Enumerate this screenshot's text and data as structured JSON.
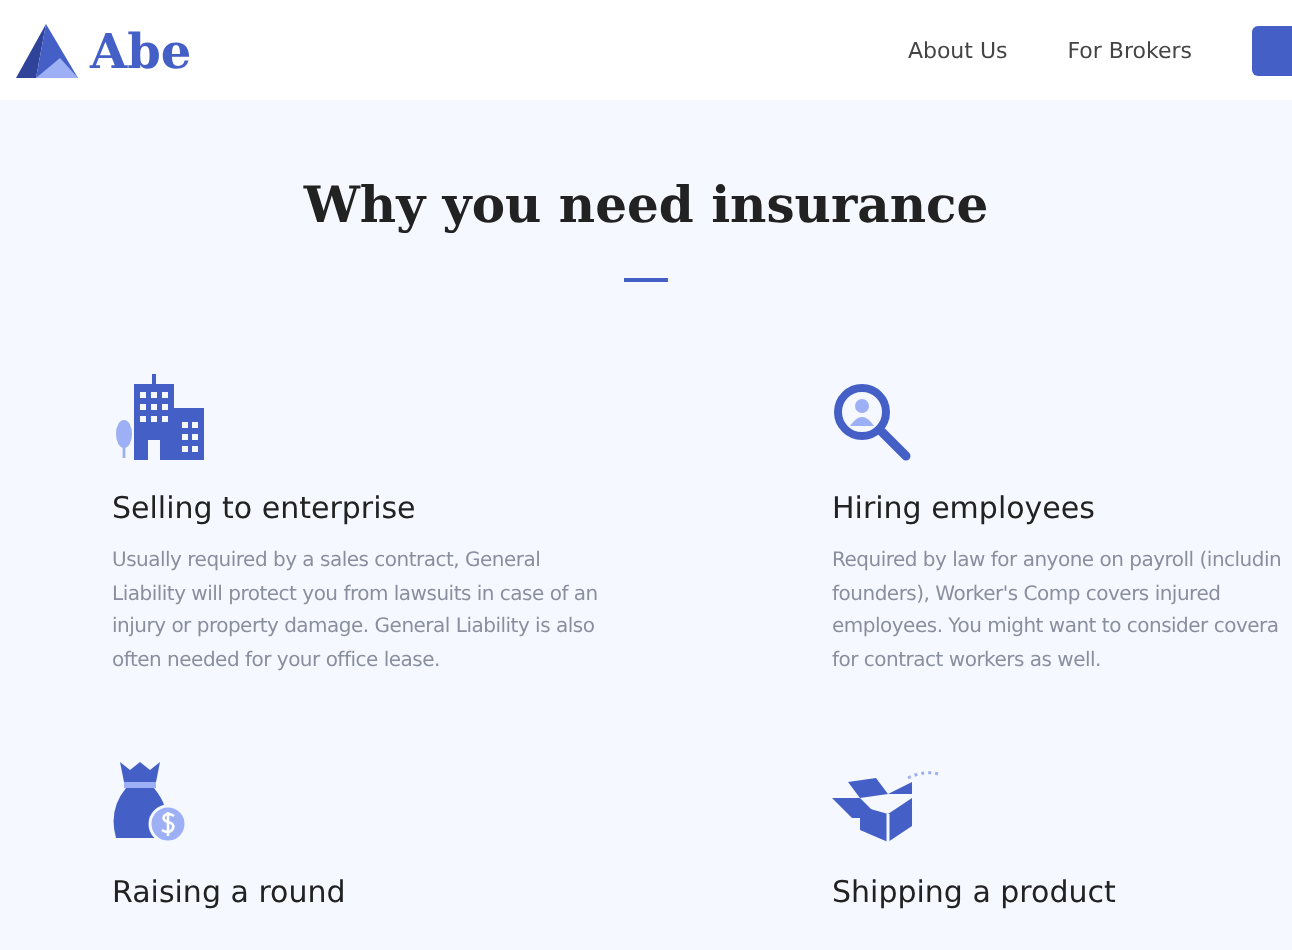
{
  "header": {
    "logo": "Abe",
    "nav": [
      {
        "label": "About Us"
      },
      {
        "label": "For Brokers"
      }
    ]
  },
  "section": {
    "title": "Why you need insurance",
    "features": [
      {
        "kind": "buildings",
        "title": "Selling to enterprise",
        "lines": [
          "Usually required by a sales contract, General",
          "Liability will protect you from lawsuits in case of an",
          "injury or property damage. General Liability is also",
          "often needed for your office lease."
        ]
      },
      {
        "kind": "magnifier",
        "title": "Hiring employees",
        "lines": [
          "Required by law for anyone on payroll (includin",
          "founders), Worker's Comp covers injured",
          "employees. You might want to consider covera",
          "for contract workers as well."
        ]
      },
      {
        "kind": "moneybag",
        "title": "Raising a round"
      },
      {
        "kind": "box",
        "title": "Shipping a product"
      }
    ]
  }
}
